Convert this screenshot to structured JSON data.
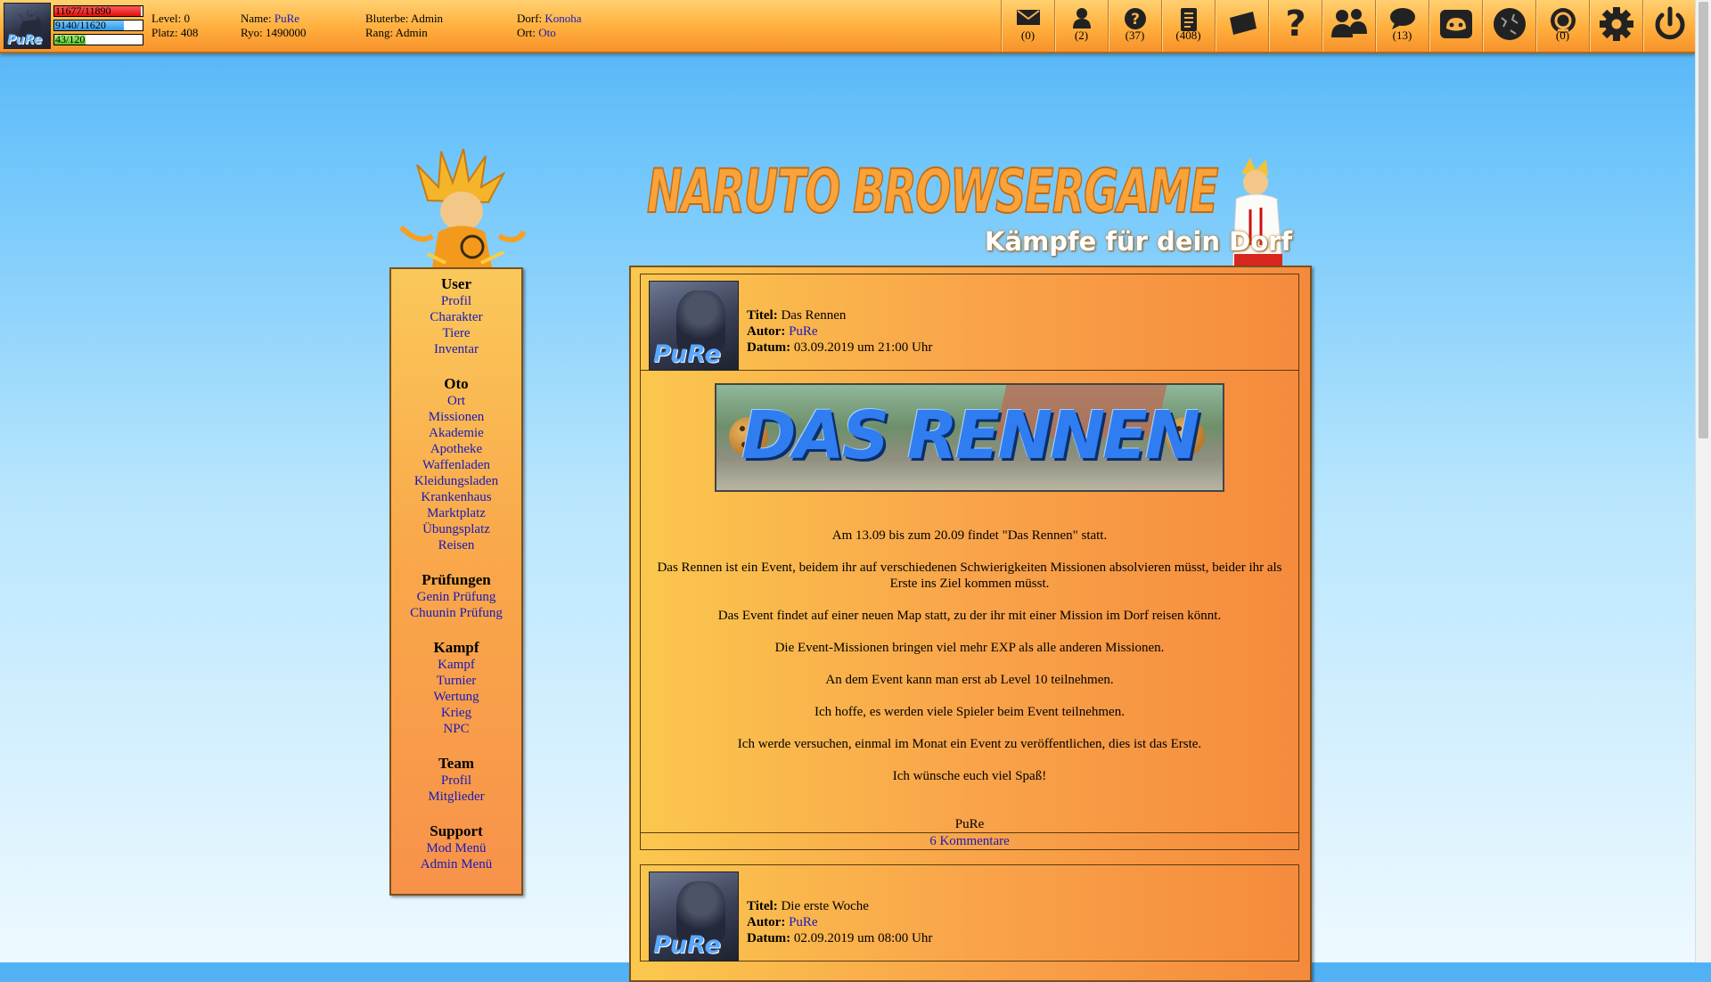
{
  "topbar": {
    "hp": {
      "text": "11677/11890",
      "fraction": 0.982
    },
    "chakra": {
      "text": "9140/11620",
      "fraction": 0.787
    },
    "exp": {
      "text": "43/120",
      "fraction": 0.358
    },
    "level_label": "Level:",
    "level": "0",
    "platz_label": "Platz:",
    "platz": "408",
    "name_label": "Name:",
    "name": "PuRe",
    "ryo_label": "Ryo:",
    "ryo": "1490000",
    "bluterbe_label": "Bluterbe:",
    "bluterbe": "Admin",
    "rang_label": "Rang:",
    "rang": "Admin",
    "dorf_label": "Dorf:",
    "dorf": "Konoha",
    "ort_label": "Ort:",
    "ort": "Oto",
    "avatar_text": "PuRe",
    "icons": [
      {
        "name": "mail-icon",
        "count": "(0)"
      },
      {
        "name": "user-icon",
        "count": "(2)"
      },
      {
        "name": "question-circle-icon",
        "count": "(37)"
      },
      {
        "name": "document-icon",
        "count": "(408)"
      },
      {
        "name": "ticket-icon",
        "count": ""
      },
      {
        "name": "help-icon",
        "count": ""
      },
      {
        "name": "group-icon",
        "count": ""
      },
      {
        "name": "chat-bubble-icon",
        "count": "(13)"
      },
      {
        "name": "discord-icon",
        "count": ""
      },
      {
        "name": "globe-icon",
        "count": ""
      },
      {
        "name": "akatsuki-icon",
        "count": "(0)"
      },
      {
        "name": "gear-icon",
        "count": ""
      },
      {
        "name": "power-icon",
        "count": ""
      }
    ],
    "accent_color": "#f9a43a"
  },
  "header": {
    "logo_text": "NARUTO BROWSERGAME",
    "slogan": "Kämpfe für dein Dorf"
  },
  "sidebar": [
    {
      "title": "User",
      "links": [
        "Profil",
        "Charakter",
        "Tiere",
        "Inventar"
      ]
    },
    {
      "title": "Oto",
      "links": [
        "Ort",
        "Missionen",
        "Akademie",
        "Apotheke",
        "Waffenladen",
        "Kleidungsladen",
        "Krankenhaus",
        "Marktplatz",
        "Übungsplatz",
        "Reisen"
      ]
    },
    {
      "title": "Prüfungen",
      "links": [
        "Genin Prüfung",
        "Chuunin Prüfung"
      ]
    },
    {
      "title": "Kampf",
      "links": [
        "Kampf",
        "Turnier",
        "Wertung",
        "Krieg",
        "NPC"
      ]
    },
    {
      "title": "Team",
      "links": [
        "Profil",
        "Mitglieder"
      ]
    },
    {
      "title": "Support",
      "links": [
        "Mod Menü",
        "Admin Menü"
      ]
    }
  ],
  "posts": [
    {
      "avatar_text": "PuRe",
      "title_label": "Titel:",
      "title": "Das Rennen",
      "author_label": "Autor:",
      "author": "PuRe",
      "date_label": "Datum:",
      "date": "03.09.2019 um 21:00 Uhr",
      "banner_text": "DAS RENNEN",
      "paragraphs": [
        "Am 13.09 bis zum 20.09 findet \"Das Rennen\" statt.",
        "Das Rennen ist ein Event, beidem ihr auf verschiedenen Schwierigkeiten Missionen absolvieren müsst, beider ihr als Erste ins Ziel kommen müsst.",
        "Das Event findet auf einer neuen Map statt, zu der ihr mit einer Mission im Dorf reisen könnt.",
        "Die Event-Missionen bringen viel mehr EXP als alle anderen Missionen.",
        "An dem Event kann man erst ab Level 10 teilnehmen.",
        "Ich hoffe, es werden viele Spieler beim Event teilnehmen.",
        "Ich werde versuchen, einmal im Monat ein Event zu veröffentlichen, dies ist das Erste.",
        "Ich wünsche euch viel Spaß!"
      ],
      "signature": "PuRe",
      "comments": "6 Kommentare"
    },
    {
      "avatar_text": "PuRe",
      "title_label": "Titel:",
      "title": "Die erste Woche",
      "author_label": "Autor:",
      "author": "PuRe",
      "date_label": "Datum:",
      "date": "02.09.2019 um 08:00 Uhr"
    }
  ]
}
